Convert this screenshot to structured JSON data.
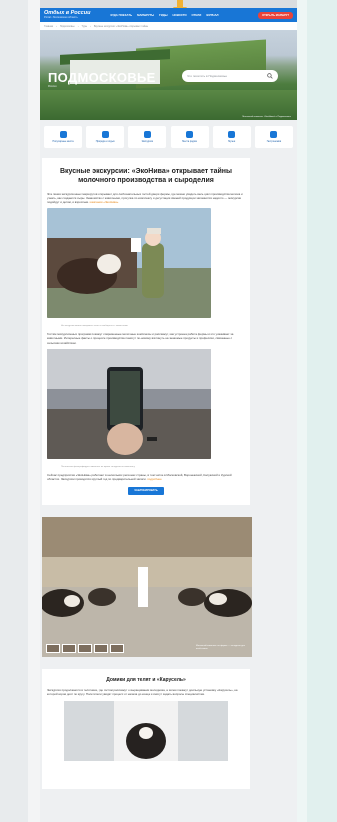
{
  "header": {
    "logo_title": "Отдых в России",
    "logo_sub": "Portal • Московская область",
    "nav": [
      "КУДА ПОЕХАТЬ",
      "МАРШРУТЫ",
      "ГИДЫ",
      "НОВОСТИ",
      "ОТЕЛИ",
      "ЖУРНАЛ"
    ],
    "cta": "ОТКРЫТЬ МАРШРУТ"
  },
  "breadcrumbs": [
    "Главная",
    "Подмосковье",
    "Туры",
    "Вкусные экскурсии: «ЭкоНива» открывает тайны"
  ],
  "hero": {
    "title": "ПОДМОСКОВЬЕ",
    "subtitle": "Россия",
    "search_placeholder": "Что посетить в Подмосковье",
    "caption": "Молочный комплекс «ЭкоНива» в Подмосковье"
  },
  "categories": [
    {
      "label": "Популярные места",
      "icon": "landmark-icon"
    },
    {
      "label": "Природа и отдых",
      "icon": "tree-icon"
    },
    {
      "label": "Экскурсии",
      "icon": "map-icon"
    },
    {
      "label": "Места рядом",
      "icon": "pin-icon"
    },
    {
      "label": "Музеи",
      "icon": "museum-icon"
    },
    {
      "label": "Гастрономия",
      "icon": "food-icon"
    }
  ],
  "article": {
    "title": "Вкусные экскурсии: «ЭкоНива» открывает тайны молочного производства и сыроделия",
    "intro": "Эта линия экскурсионных маршрутов открывает для любознательных гостей двери фермы, где можно увидеть весь цикл производства молока и узнать, как создаются сыры. Знакомство с животными, прогулка по комплексу и дегустация свежей продукции запомнятся надолго — экскурсии подойдут и детям, и взрослым.",
    "intro_link": "компании «ЭкоНива»",
    "caption1": "На экскурсии можно покормить телят и пообщаться с животными",
    "para2": "Гостям экскурсионных программ покажут современные молочные комплексы и расскажут, как устроена работа фермы и кто ухаживает за животными. Интересные факты о процессе производства помогут по-новому взглянуть на знакомые продукты и профессии, связанные с сельским хозяйством.",
    "caption2": "Посетители фотографируют животных во время экскурсии по комплексу",
    "para3": "Сейчас предприятия «ЭкоНива» работают в нескольких регионах страны, в том числе в Московской, Воронежской, Калужской и Курской областях. Экскурсии проводятся круглый год по предварительной записи.",
    "para3_link": "подробнее",
    "button": "ЗАБРОНИРОВАТЬ",
    "gallery_caption": "Молочный комплекс на ферме — экскурсия для всей семьи"
  },
  "article2": {
    "title": "Домики для телят и «Карусель»",
    "text": "Экскурсия продолжается в телятнике, где гостям расскажут о выращивании молодняка, а затем покажут доильную установку «Карусель», на которой коров доят по кругу. Посетители увидят процесс от начала до конца и смогут задать вопросы специалистам."
  },
  "colors": {
    "brand": "#1876d6",
    "accent": "#e8433a",
    "link": "#e58a1f"
  }
}
